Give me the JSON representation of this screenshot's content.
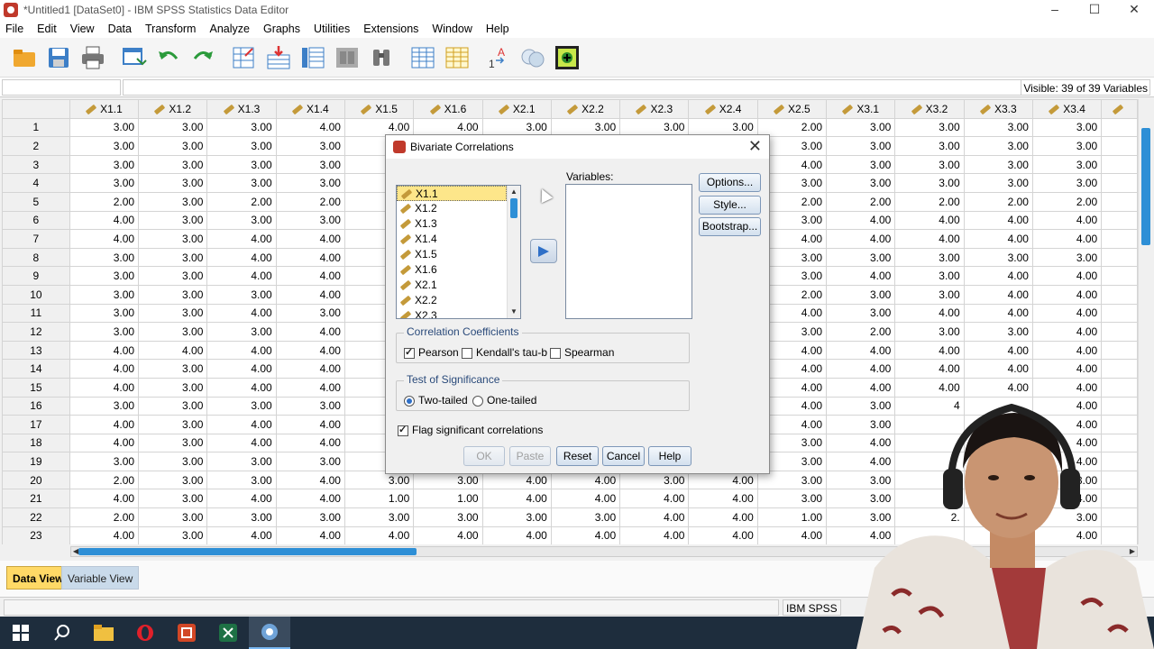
{
  "window": {
    "title": "*Untitled1 [DataSet0] - IBM SPSS Statistics Data Editor",
    "controls": [
      "–",
      "☐",
      "✕"
    ]
  },
  "menu": [
    "File",
    "Edit",
    "View",
    "Data",
    "Transform",
    "Analyze",
    "Graphs",
    "Utilities",
    "Extensions",
    "Window",
    "Help"
  ],
  "toolbar": [
    "open-icon",
    "save-icon",
    "print-icon",
    "dialog-recall-icon",
    "undo-icon",
    "redo-icon",
    "goto-case-icon",
    "goto-variable-icon",
    "variables-icon",
    "run-descriptives-icon",
    "find-icon",
    "insert-cases-icon",
    "insert-variable-icon",
    "value-labels-icon",
    "use-sets-icon",
    "customize-icon"
  ],
  "refrow": {
    "visible": "Visible: 39 of 39 Variables"
  },
  "grid": {
    "columns": [
      "X1.1",
      "X1.2",
      "X1.3",
      "X1.4",
      "X1.5",
      "X1.6",
      "X2.1",
      "X2.2",
      "X2.3",
      "X2.4",
      "X2.5",
      "X3.1",
      "X3.2",
      "X3.3",
      "X3.4"
    ],
    "rows": [
      [
        "1",
        "3.00",
        "3.00",
        "3.00",
        "4.00",
        "4.00",
        "4.00",
        "3.00",
        "3.00",
        "3.00",
        "3.00",
        "2.00",
        "3.00",
        "3.00",
        "3.00",
        "3.00"
      ],
      [
        "2",
        "3.00",
        "3.00",
        "3.00",
        "3.00",
        "",
        "",
        "",
        "",
        "",
        "",
        "3.00",
        "3.00",
        "3.00",
        "3.00",
        "3.00"
      ],
      [
        "3",
        "3.00",
        "3.00",
        "3.00",
        "3.00",
        "",
        "",
        "",
        "",
        "",
        "",
        "4.00",
        "3.00",
        "3.00",
        "3.00",
        "3.00"
      ],
      [
        "4",
        "3.00",
        "3.00",
        "3.00",
        "3.00",
        "",
        "",
        "",
        "",
        "",
        "",
        "3.00",
        "3.00",
        "3.00",
        "3.00",
        "3.00"
      ],
      [
        "5",
        "2.00",
        "3.00",
        "2.00",
        "2.00",
        "",
        "",
        "",
        "",
        "",
        "",
        "2.00",
        "2.00",
        "2.00",
        "2.00",
        "2.00"
      ],
      [
        "6",
        "4.00",
        "3.00",
        "3.00",
        "3.00",
        "",
        "",
        "",
        "",
        "",
        "",
        "3.00",
        "4.00",
        "4.00",
        "4.00",
        "4.00"
      ],
      [
        "7",
        "4.00",
        "3.00",
        "4.00",
        "4.00",
        "",
        "",
        "",
        "",
        "",
        "",
        "4.00",
        "4.00",
        "4.00",
        "4.00",
        "4.00"
      ],
      [
        "8",
        "3.00",
        "3.00",
        "4.00",
        "4.00",
        "",
        "",
        "",
        "",
        "",
        "",
        "3.00",
        "3.00",
        "3.00",
        "3.00",
        "3.00"
      ],
      [
        "9",
        "3.00",
        "3.00",
        "4.00",
        "4.00",
        "",
        "",
        "",
        "",
        "",
        "",
        "3.00",
        "4.00",
        "3.00",
        "4.00",
        "4.00"
      ],
      [
        "10",
        "3.00",
        "3.00",
        "3.00",
        "4.00",
        "",
        "",
        "",
        "",
        "",
        "",
        "2.00",
        "3.00",
        "3.00",
        "4.00",
        "4.00"
      ],
      [
        "11",
        "3.00",
        "3.00",
        "4.00",
        "3.00",
        "",
        "",
        "",
        "",
        "",
        "",
        "4.00",
        "3.00",
        "4.00",
        "4.00",
        "4.00"
      ],
      [
        "12",
        "3.00",
        "3.00",
        "3.00",
        "4.00",
        "",
        "",
        "",
        "",
        "",
        "",
        "3.00",
        "2.00",
        "3.00",
        "3.00",
        "4.00"
      ],
      [
        "13",
        "4.00",
        "4.00",
        "4.00",
        "4.00",
        "",
        "",
        "",
        "",
        "",
        "",
        "4.00",
        "4.00",
        "4.00",
        "4.00",
        "4.00"
      ],
      [
        "14",
        "4.00",
        "3.00",
        "4.00",
        "4.00",
        "",
        "",
        "",
        "",
        "",
        "",
        "4.00",
        "4.00",
        "4.00",
        "4.00",
        "4.00"
      ],
      [
        "15",
        "4.00",
        "3.00",
        "4.00",
        "4.00",
        "",
        "",
        "",
        "",
        "",
        "",
        "4.00",
        "4.00",
        "4.00",
        "4.00",
        "4.00"
      ],
      [
        "16",
        "3.00",
        "3.00",
        "3.00",
        "3.00",
        "",
        "",
        "",
        "",
        "",
        "",
        "4.00",
        "3.00",
        "4",
        "",
        "4.00"
      ],
      [
        "17",
        "4.00",
        "3.00",
        "4.00",
        "4.00",
        "",
        "",
        "",
        "",
        "",
        "",
        "4.00",
        "3.00",
        "",
        "",
        "4.00"
      ],
      [
        "18",
        "4.00",
        "3.00",
        "4.00",
        "4.00",
        "",
        "",
        "",
        "",
        "",
        "",
        "3.00",
        "4.00",
        "",
        "",
        "4.00"
      ],
      [
        "19",
        "3.00",
        "3.00",
        "3.00",
        "3.00",
        "",
        "",
        "",
        "",
        "",
        "",
        "3.00",
        "4.00",
        "",
        "",
        "4.00"
      ],
      [
        "20",
        "2.00",
        "3.00",
        "3.00",
        "4.00",
        "3.00",
        "3.00",
        "4.00",
        "4.00",
        "3.00",
        "4.00",
        "3.00",
        "3.00",
        "",
        "",
        "3.00"
      ],
      [
        "21",
        "4.00",
        "3.00",
        "4.00",
        "4.00",
        "1.00",
        "1.00",
        "4.00",
        "4.00",
        "4.00",
        "4.00",
        "3.00",
        "3.00",
        "",
        "",
        "4.00"
      ],
      [
        "22",
        "2.00",
        "3.00",
        "3.00",
        "3.00",
        "3.00",
        "3.00",
        "3.00",
        "3.00",
        "4.00",
        "4.00",
        "1.00",
        "3.00",
        "2.",
        "",
        "3.00"
      ],
      [
        "23",
        "4.00",
        "3.00",
        "4.00",
        "4.00",
        "4.00",
        "4.00",
        "4.00",
        "4.00",
        "4.00",
        "4.00",
        "4.00",
        "4.00",
        "",
        "",
        "4.00"
      ]
    ]
  },
  "tabs": {
    "data_view": "Data View",
    "variable_view": "Variable View"
  },
  "status": {
    "processor": "IBM SPSS"
  },
  "dialog": {
    "title": "Bivariate Correlations",
    "source_items": [
      "X1.1",
      "X1.2",
      "X1.3",
      "X1.4",
      "X1.5",
      "X1.6",
      "X2.1",
      "X2.2",
      "X2.3"
    ],
    "variables_label": "Variables:",
    "side_buttons": {
      "options": "Options...",
      "style": "Style...",
      "bootstrap": "Bootstrap..."
    },
    "coeff_group": {
      "title": "Correlation Coefficients",
      "pearson": "Pearson",
      "kendall": "Kendall's tau-b",
      "spearman": "Spearman"
    },
    "sig_group": {
      "title": "Test of Significance",
      "two_tailed": "Two-tailed",
      "one_tailed": "One-tailed"
    },
    "flag": "Flag significant correlations",
    "buttons": {
      "ok": "OK",
      "paste": "Paste",
      "reset": "Reset",
      "cancel": "Cancel",
      "help": "Help"
    }
  }
}
